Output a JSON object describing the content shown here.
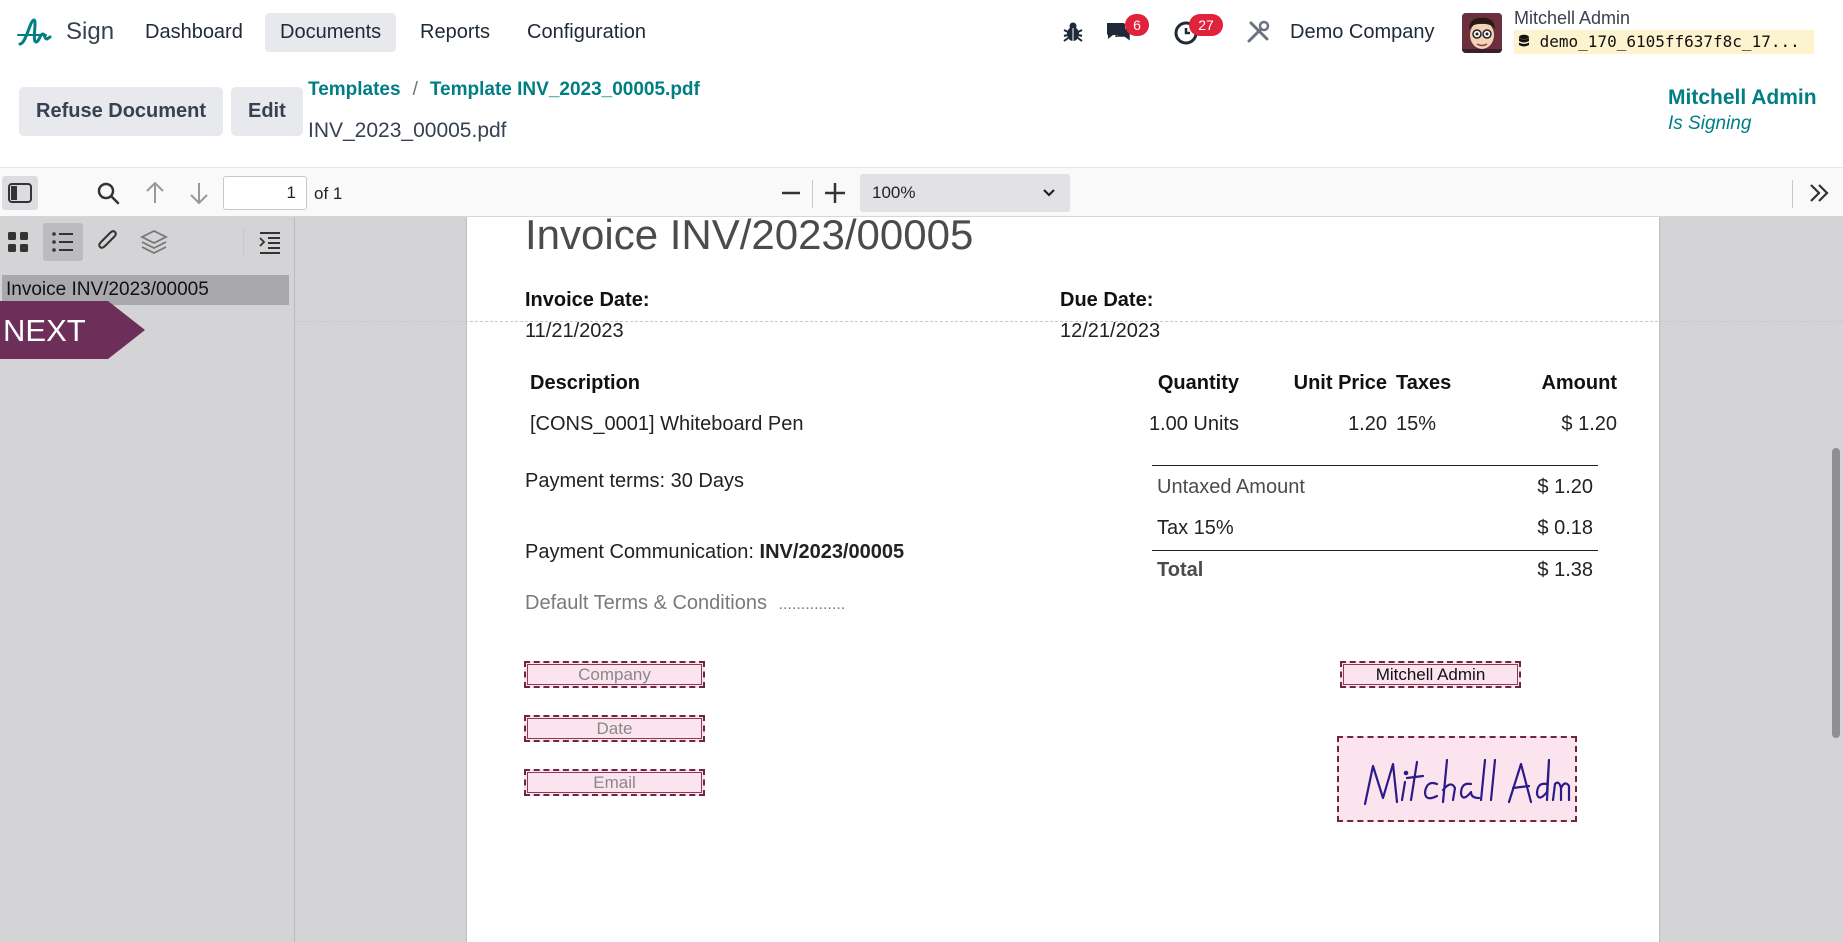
{
  "app": {
    "name": "Sign"
  },
  "menu": {
    "items": [
      "Dashboard",
      "Documents",
      "Reports",
      "Configuration"
    ],
    "active": "Documents"
  },
  "systray": {
    "messages_count": "6",
    "activities_count": "27",
    "company": "Demo Company",
    "user_name": "Mitchell Admin",
    "database": "demo_170_6105ff637f8c_17..."
  },
  "control_panel": {
    "refuse_label": "Refuse Document",
    "edit_label": "Edit",
    "breadcrumb": [
      "Templates",
      "Template INV_2023_00005.pdf"
    ],
    "document_title": "INV_2023_00005.pdf",
    "signer_name": "Mitchell Admin",
    "signer_status": "Is Signing"
  },
  "pdf_toolbar": {
    "page_number": "1",
    "page_of": "of 1",
    "zoom": "100%"
  },
  "sidebar": {
    "outline_item": "Invoice INV/2023/00005",
    "next_label": "NEXT"
  },
  "invoice": {
    "title": "Invoice INV/2023/00005",
    "invoice_date_label": "Invoice Date:",
    "invoice_date": "11/21/2023",
    "due_date_label": "Due Date:",
    "due_date": "12/21/2023",
    "columns": [
      "Description",
      "Quantity",
      "Unit Price",
      "Taxes",
      "Amount"
    ],
    "line": {
      "description": "[CONS_0001] Whiteboard Pen",
      "quantity": "1.00 Units",
      "unit_price": "1.20",
      "taxes": "15%",
      "amount": "$ 1.20"
    },
    "payment_terms": "Payment terms: 30 Days",
    "payment_comm_label": "Payment Communication:",
    "payment_comm_value": "INV/2023/00005",
    "terms": "Default Terms & Conditions",
    "terms_dots": "...............",
    "totals": [
      {
        "label": "Untaxed Amount",
        "value": "$ 1.20"
      },
      {
        "label": "Tax 15%",
        "value": "$ 0.18"
      },
      {
        "label": "Total",
        "value": "$ 1.38"
      }
    ]
  },
  "sign_fields": {
    "company": "Company",
    "date": "Date",
    "email": "Email",
    "name": "Mitchell Admin",
    "signature": "Mitchell Admin"
  },
  "colors": {
    "accent": "#017e84",
    "field_bg": "#fce4ee",
    "field_border": "#6d2840",
    "next_flag": "#6d2e5a",
    "badge": "#e0223b"
  }
}
